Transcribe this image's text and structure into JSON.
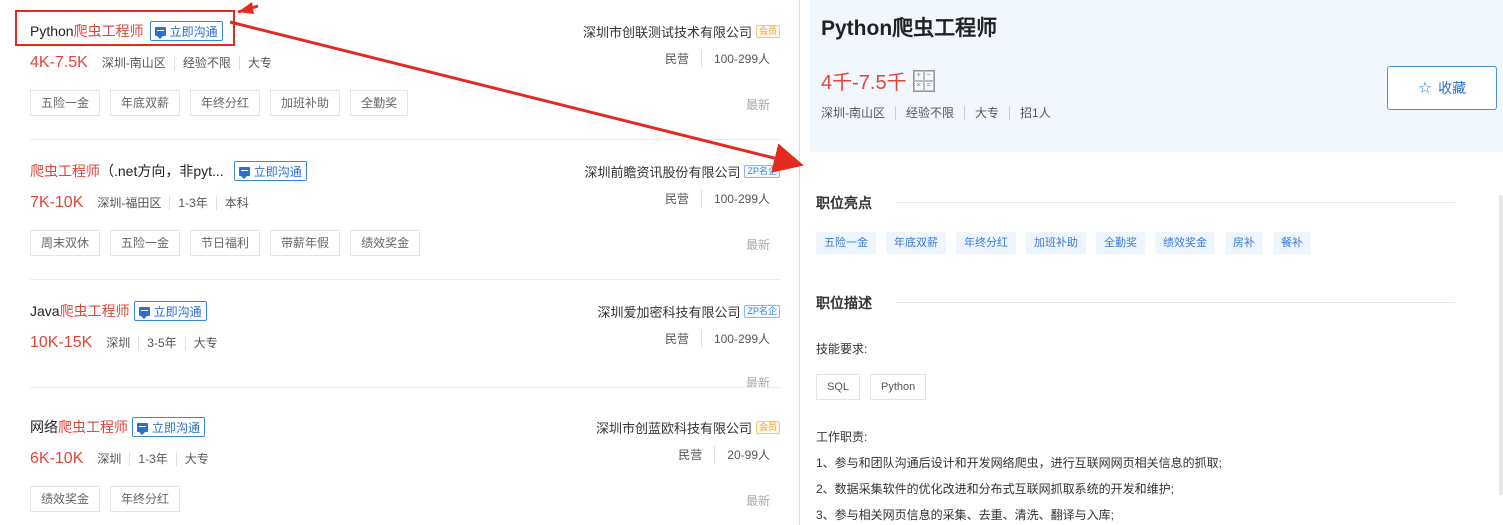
{
  "jobs": [
    {
      "title_prefix": "Python",
      "title_hl": "爬虫工程师",
      "title_suffix": "",
      "chat_label": "立即沟通",
      "salary": "4K-7.5K",
      "location": "深圳-南山区",
      "experience": "经验不限",
      "education": "大专",
      "company": "深圳市创联测试技术有限公司",
      "badge": "会员",
      "company_type": "民营",
      "company_size": "100-299人",
      "tags": [
        "五险一金",
        "年底双薪",
        "年终分红",
        "加班补助",
        "全勤奖"
      ],
      "latest": "最新"
    },
    {
      "title_prefix": "",
      "title_hl": "爬虫工程师",
      "title_suffix": "（.net方向，非pyt...",
      "chat_label": "立即沟通",
      "salary": "7K-10K",
      "location": "深圳-福田区",
      "experience": "1-3年",
      "education": "本科",
      "company": "深圳前瞻资讯股份有限公司",
      "badge": "ZP名企",
      "company_type": "民营",
      "company_size": "100-299人",
      "tags": [
        "周末双休",
        "五险一金",
        "节日福利",
        "带薪年假",
        "绩效奖金"
      ],
      "latest": "最新"
    },
    {
      "title_prefix": "Java",
      "title_hl": "爬虫工程师",
      "title_suffix": "",
      "chat_label": "立即沟通",
      "salary": "10K-15K",
      "location": "深圳",
      "experience": "3-5年",
      "education": "大专",
      "company": "深圳爱加密科技有限公司",
      "badge": "ZP名企",
      "company_type": "民营",
      "company_size": "100-299人",
      "tags": [],
      "latest": "最新"
    },
    {
      "title_prefix": "网络",
      "title_hl": "爬虫工程师",
      "title_suffix": "",
      "chat_label": "立即沟通",
      "salary": "6K-10K",
      "location": "深圳",
      "experience": "1-3年",
      "education": "大专",
      "company": "深圳市创蓝欧科技有限公司",
      "badge": "会员",
      "company_type": "民营",
      "company_size": "20-99人",
      "tags": [
        "绩效奖金",
        "年终分红"
      ],
      "latest": "最新"
    }
  ],
  "detail": {
    "title": "Python爬虫工程师",
    "salary": "4千-7.5千",
    "meta": [
      "深圳-南山区",
      "经验不限",
      "大专",
      "招1人"
    ],
    "favorite_label": "收藏",
    "highlights_title": "职位亮点",
    "highlights": [
      "五险一金",
      "年底双薪",
      "年终分红",
      "加班补助",
      "全勤奖",
      "绩效奖金",
      "房补",
      "餐补"
    ],
    "description_title": "职位描述",
    "skills_label": "技能要求:",
    "skills": [
      "SQL",
      "Python"
    ],
    "duties_label": "工作职责:",
    "duties": [
      "1、参与和团队沟通后设计和开发网络爬虫，进行互联网网页相关信息的抓取;",
      "2、数据采集软件的优化改进和分布式互联网抓取系统的开发和维护;",
      "3、参与相关网页信息的采集、去重、清洗、翻译与入库;"
    ]
  },
  "colors": {
    "highlight_red": "#e0453a",
    "accent_blue": "#2c6fcf",
    "annotation_red": "#e32a1e"
  }
}
